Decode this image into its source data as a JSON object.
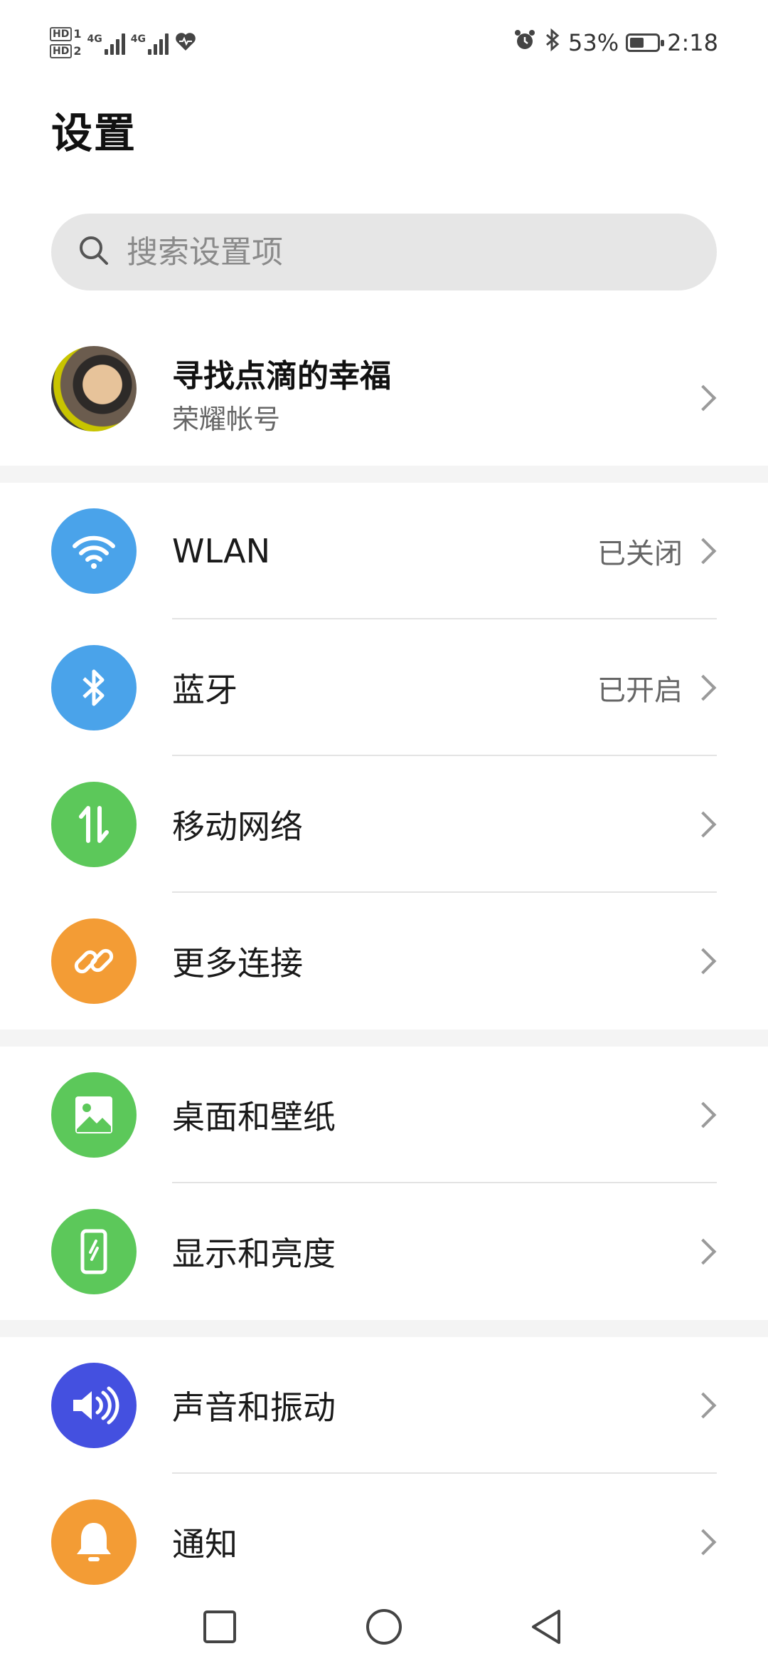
{
  "status_bar": {
    "hd1": "HD",
    "hd1_sub": "1",
    "hd2": "HD",
    "hd2_sub": "2",
    "signal1_label": "4G",
    "signal2_label": "4G",
    "battery_percent": "53%",
    "battery_level": 0.53,
    "time": "2:18"
  },
  "page": {
    "title": "设置"
  },
  "search": {
    "placeholder": "搜索设置项"
  },
  "account": {
    "name": "寻找点滴的幸福",
    "subtitle": "荣耀帐号"
  },
  "settings": [
    {
      "label": "WLAN",
      "value": "已关闭",
      "icon": "wifi-icon",
      "color": "#4aa3ea"
    },
    {
      "label": "蓝牙",
      "value": "已开启",
      "icon": "bluetooth-icon",
      "color": "#4aa3ea"
    },
    {
      "label": "移动网络",
      "value": "",
      "icon": "mobile-data-icon",
      "color": "#5cc85a"
    },
    {
      "label": "更多连接",
      "value": "",
      "icon": "link-icon",
      "color": "#f39c35"
    },
    {
      "label": "桌面和壁纸",
      "value": "",
      "icon": "image-icon",
      "color": "#5cc85a"
    },
    {
      "label": "显示和亮度",
      "value": "",
      "icon": "phone-brightness-icon",
      "color": "#5cc85a"
    },
    {
      "label": "声音和振动",
      "value": "",
      "icon": "speaker-icon",
      "color": "#4450e0"
    },
    {
      "label": "通知",
      "value": "",
      "icon": "bell-icon",
      "color": "#f39c35"
    }
  ]
}
